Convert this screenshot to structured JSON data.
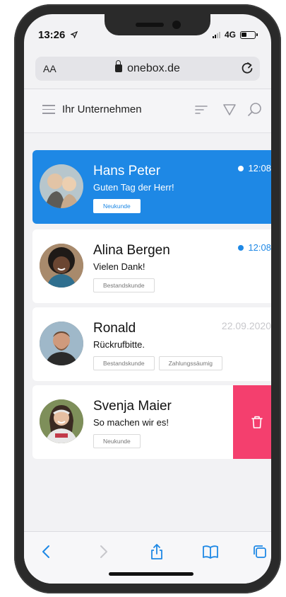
{
  "status": {
    "time": "13:26",
    "network": "4G"
  },
  "browser": {
    "text_size": "AA",
    "domain": "onebox.de"
  },
  "app": {
    "title": "Ihr Unternehmen"
  },
  "conversations": [
    {
      "name": "Hans Peter",
      "message": "Guten Tag der Herr!",
      "time": "12:08",
      "unread": true,
      "tags": [
        "Neukunde"
      ]
    },
    {
      "name": "Alina Bergen",
      "message": "Vielen Dank!",
      "time": "12:08",
      "unread": true,
      "tags": [
        "Bestandskunde"
      ]
    },
    {
      "name": "Ronald",
      "message": "Rückrufbitte.",
      "time": "22.09.2020",
      "unread": false,
      "tags": [
        "Bestandskunde",
        "Zahlungssäumig"
      ]
    },
    {
      "name": "Svenja Maier",
      "message": "So machen wir es!",
      "time": "",
      "unread": false,
      "tags": [
        "Neukunde"
      ]
    }
  ],
  "colors": {
    "accent": "#1e88e5",
    "delete": "#f43f6e",
    "background": "#f2f2f4"
  },
  "icons": [
    "menu-icon",
    "sort-icon",
    "filter-icon",
    "search-icon",
    "trash-icon",
    "back-icon",
    "forward-icon",
    "share-icon",
    "bookmarks-icon",
    "tabs-icon",
    "reload-icon",
    "lock-icon"
  ]
}
